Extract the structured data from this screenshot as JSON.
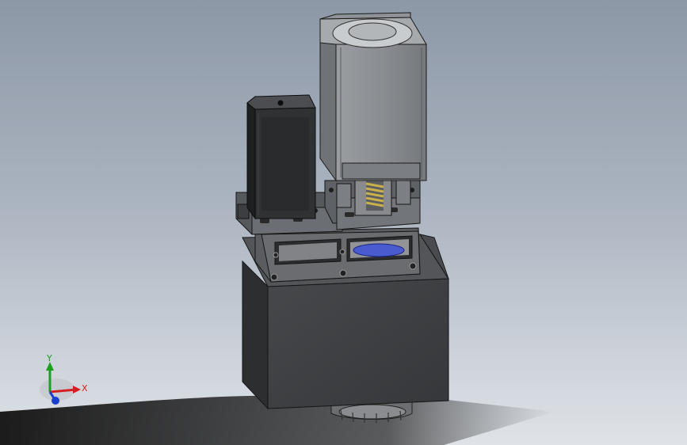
{
  "viewport": {
    "background_top": "#8d98a7",
    "background_bottom": "#dfe3e8"
  },
  "model": {
    "parts": [
      "small-stepper-motor",
      "large-servo-motor",
      "spring-coupling",
      "mounting-plate",
      "galvo-housing",
      "lens-mount"
    ],
    "colors": {
      "housing": "#3b3d40",
      "motor_large": "#8c8f93",
      "motor_small": "#2a2b2d",
      "spring": "#b8a24a",
      "lens": "#4a5bd0"
    }
  },
  "triad": {
    "x_label": "X",
    "y_label": "Y",
    "x_color": "#d42020",
    "y_color": "#1aa01a",
    "z_color": "#1a3fd0"
  }
}
